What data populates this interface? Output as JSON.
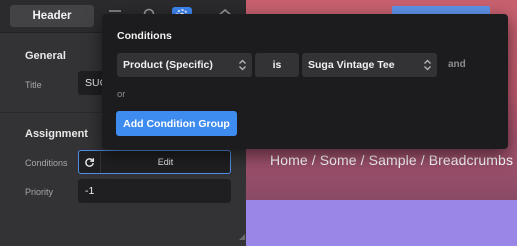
{
  "toolbar": {
    "header_tab": "Header",
    "icons": [
      "layers-icon",
      "search-icon",
      "settings-icon",
      "eye-icon"
    ]
  },
  "general": {
    "title": "General",
    "title_label": "Title",
    "title_value": "SUG"
  },
  "assignment": {
    "title": "Assignment",
    "conditions_label": "Conditions",
    "conditions_button": "Edit",
    "priority_label": "Priority",
    "priority_value": "-1"
  },
  "preview": {
    "breadcrumbs": "Home / Some / Sample / Breadcrumbs"
  },
  "conditions_popup": {
    "title": "Conditions",
    "condition": {
      "subject": "Product (Specific)",
      "operator": "is",
      "value": "Suga Vintage Tee"
    },
    "and_label": "and",
    "or_label": "or",
    "add_group_button": "Add Condition Group"
  },
  "colors": {
    "accent": "#3f8cf0",
    "panel": "#333335",
    "popup": "#1c1c1e",
    "preview_top": "#c8616f",
    "preview_bottom": "#9a86e6"
  }
}
